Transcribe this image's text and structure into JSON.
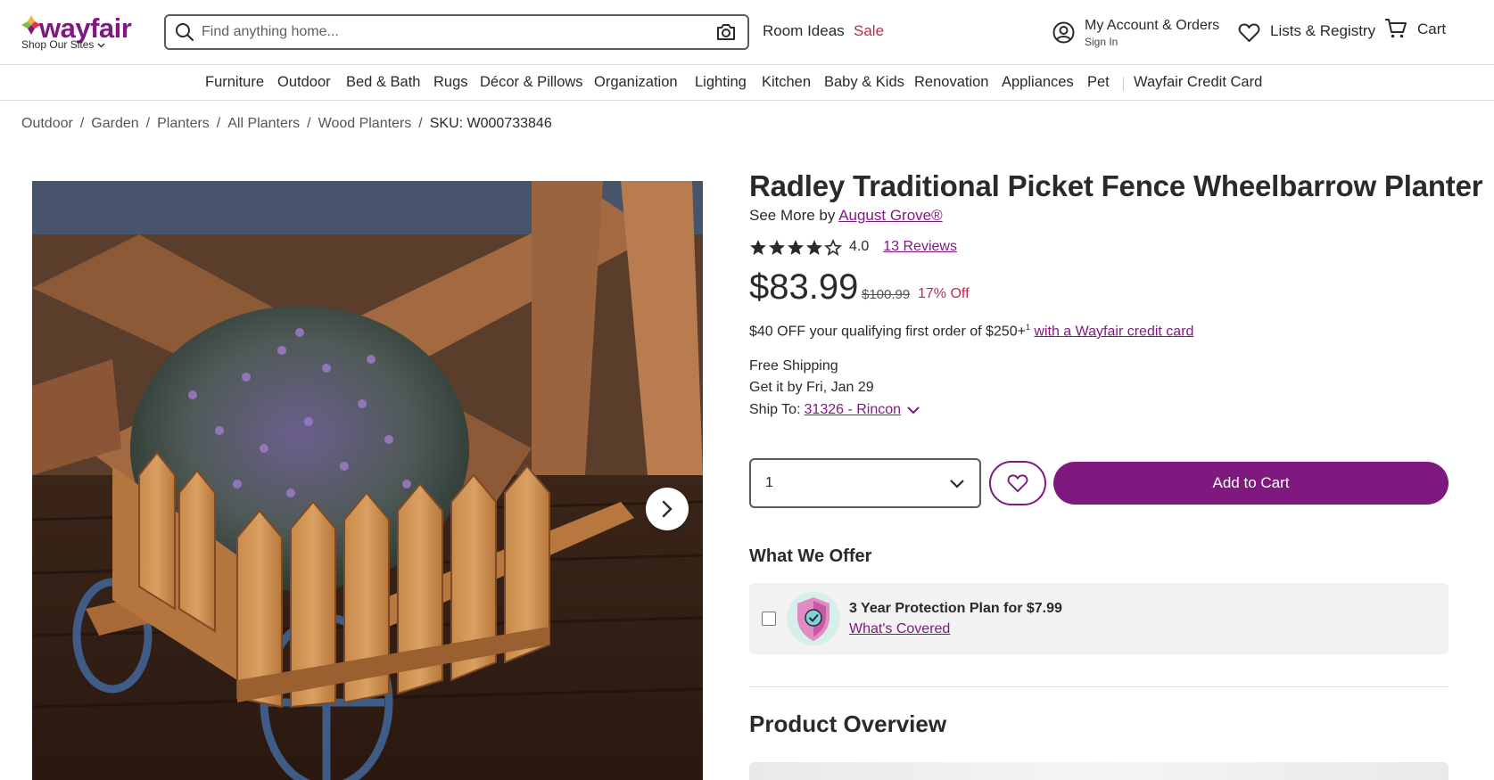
{
  "header": {
    "logo_text": "wayfair",
    "shop_sites": "Shop Our Sites",
    "search_placeholder": "Find anything home...",
    "room_ideas": "Room Ideas",
    "sale": "Sale",
    "account_title": "My Account & Orders",
    "account_sub": "Sign In",
    "lists": "Lists & Registry",
    "cart": "Cart",
    "brand_color": "#7f187f",
    "sale_color": "#c7264b"
  },
  "categories": [
    "Furniture",
    "Outdoor",
    "Bed & Bath",
    "Rugs",
    "Décor & Pillows",
    "Organization",
    "Lighting",
    "Kitchen",
    "Baby & Kids",
    "Renovation",
    "Appliances",
    "Pet",
    "Wayfair Credit Card"
  ],
  "breadcrumb": {
    "items": [
      "Outdoor",
      "Garden",
      "Planters",
      "All Planters",
      "Wood Planters"
    ],
    "separator": "/",
    "sku": "SKU: W000733846"
  },
  "product": {
    "title": "Radley Traditional Picket Fence Wheelbarrow Planter",
    "see_more_prefix": "See More by",
    "brand": "August Grove®",
    "rating_value": "4.0",
    "rating_stars": 4,
    "rating_max": 5,
    "reviews": "13 Reviews",
    "price": "$83.99",
    "was_price": "$100.99",
    "discount": "17% Off",
    "promo_text": "$40 OFF your qualifying first order of $250+",
    "promo_sup": "1",
    "promo_link": "with a Wayfair credit card",
    "shipping": "Free Shipping",
    "delivery": "Get it by Fri, Jan 29",
    "ship_to_label": "Ship To:",
    "ship_to_value": "31326 - Rincon",
    "quantity": "1",
    "add_to_cart": "Add to Cart"
  },
  "offer": {
    "heading": "What We Offer",
    "plan": "3 Year Protection Plan for $7.99",
    "plan_link": "What's Covered",
    "checked": false
  },
  "overview": {
    "heading": "Product Overview"
  },
  "icons": {
    "search": "search-icon",
    "camera": "camera-icon",
    "account": "account-icon",
    "heart": "heart-icon",
    "cart": "cart-icon",
    "chevron": "chevron-down-icon",
    "next": "chevron-right-icon",
    "shield": "shield-check-icon",
    "star": "star-icon"
  }
}
